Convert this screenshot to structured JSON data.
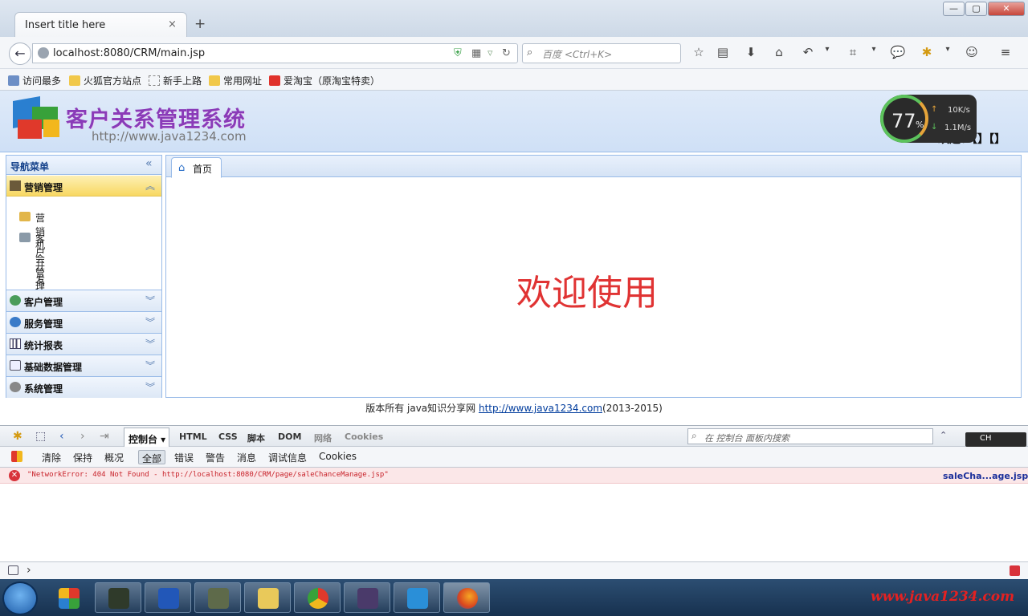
{
  "browser": {
    "tab_title": "Insert title here",
    "tab_close": "×",
    "new_tab": "+",
    "window_controls": {
      "minimize": "—",
      "maximize": "▢",
      "close": "✕"
    },
    "url": "localhost:8080/CRM/main.jsp",
    "search_placeholder": "百度 <Ctrl+K>"
  },
  "bookmarks": [
    {
      "label": "访问最多",
      "icon": "most-visited-icon"
    },
    {
      "label": "火狐官方站点",
      "icon": "folder-icon"
    },
    {
      "label": "新手上路",
      "icon": "page-icon"
    },
    {
      "label": "常用网址",
      "icon": "folder-icon"
    },
    {
      "label": "爱淘宝（原淘宝特卖）",
      "icon": "taobao-icon"
    }
  ],
  "header": {
    "system_title": "客户关系管理系统",
    "system_url": "http://www.java1234.com",
    "welcome": "欢迎：【】【】",
    "net_meter": {
      "percent": "77",
      "percent_sign": "%",
      "up": "10K/s",
      "down": "1.1M/s"
    }
  },
  "leftnav": {
    "title": "导航菜单",
    "panels": [
      {
        "label": "营销管理",
        "expanded": true,
        "items": [
          "营销机会管理",
          "客户开发计划"
        ]
      },
      {
        "label": "客户管理"
      },
      {
        "label": "服务管理"
      },
      {
        "label": "统计报表"
      },
      {
        "label": "基础数据管理"
      },
      {
        "label": "系统管理"
      }
    ]
  },
  "main": {
    "home_tab": "首页",
    "welcome_text": "欢迎使用"
  },
  "footer": {
    "prefix": "版本所有 java知识分享网 ",
    "link": "http://www.java1234.com",
    "suffix": "(2013-2015)"
  },
  "devtools": {
    "tabs": [
      "控制台 ▾",
      "HTML",
      "CSS",
      "脚本",
      "DOM",
      "网络",
      "Cookies"
    ],
    "search_placeholder": "在 控制台 面板内搜索",
    "filters": [
      "清除",
      "保持",
      "概况",
      "全部",
      "错误",
      "警告",
      "消息",
      "调试信息",
      "Cookies"
    ],
    "error_message": "\"NetworkError: 404 Not Found - http://localhost:8080/CRM/page/saleChanceManage.jsp\"",
    "error_source": "saleCha...age.jsp",
    "cmd_prompt": "›",
    "ime": "CH"
  },
  "taskbar": {
    "watermark": "www.java1234.com"
  }
}
